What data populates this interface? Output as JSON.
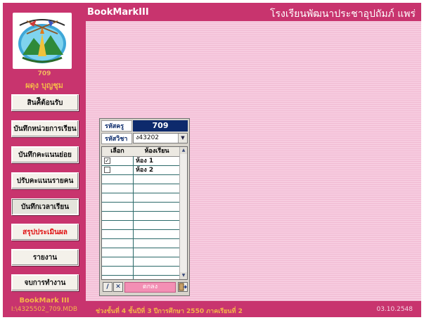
{
  "header": {
    "app_title": "BookMarkIII",
    "school_name": "โรงเรียนพัฒนาประชาอุปถัมภ์ แพร่"
  },
  "sidebar": {
    "logo_number": "709",
    "user_name": "ผดุง บุญชุม",
    "menu": [
      {
        "label": "สินค้ีต้อนรับ",
        "style": "normal"
      },
      {
        "label": "บันทึกหน่วยการเรียน",
        "style": "normal"
      },
      {
        "label": "บันทึกคะแนนย่อย",
        "style": "normal"
      },
      {
        "label": "ปรับคะแนนรายคน",
        "style": "normal"
      },
      {
        "label": "บันทึกเวลาเรียน",
        "style": "active"
      },
      {
        "label": "สรุปประเมินผล",
        "style": "red"
      },
      {
        "label": "รายงาน",
        "style": "normal"
      },
      {
        "label": "จบการทำงาน",
        "style": "normal"
      }
    ],
    "app_name": "BookMark III",
    "db_path": "I:\\4325502_709.MDB"
  },
  "status": {
    "info": "ช่วงชั้นที่ 4  ชั้นปีที่ 3  ปีการศึกษา 2550  ภาคเรียนที่ 2",
    "date": "03.10.2548"
  },
  "dialog": {
    "teacher_code_label": "รหัสครู",
    "teacher_code": "709",
    "subject_code_label": "รหัสวิชา",
    "subject_code": "ง43202",
    "grid_headers": {
      "select": "เลือก",
      "room": "ห้องเรียน"
    },
    "rows": [
      {
        "checked": true,
        "room": "ห้อง 1"
      },
      {
        "checked": false,
        "room": "ห้อง 2"
      }
    ],
    "edit_icon": "pencil-icon",
    "delete_icon": "x-icon",
    "ok_label": "ตกลง",
    "exit_icon": "exit-door-icon"
  }
}
